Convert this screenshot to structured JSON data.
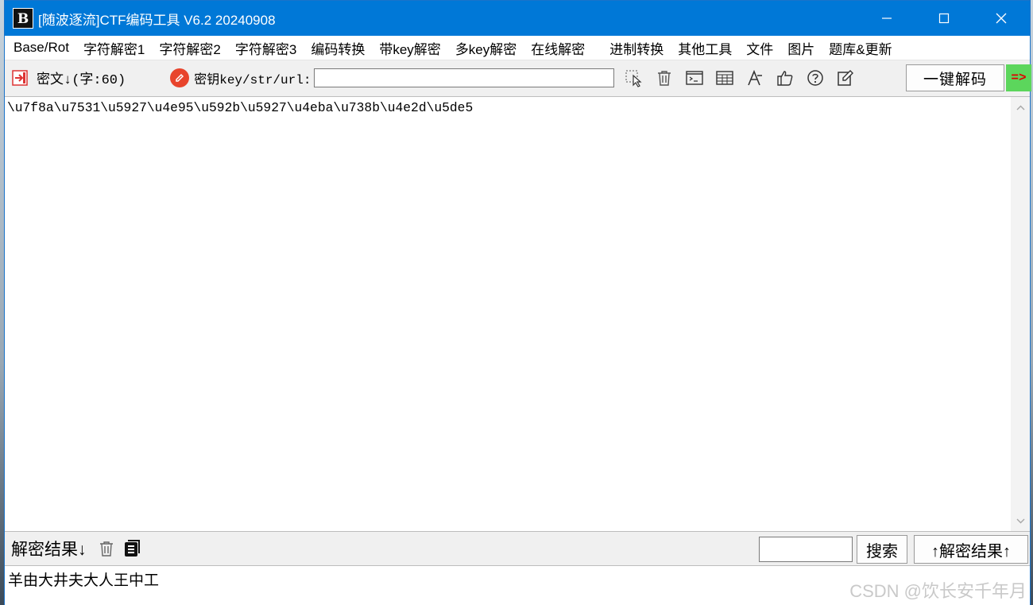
{
  "window": {
    "logo": "B",
    "title": "[随波逐流]CTF编码工具 V6.2 20240908"
  },
  "menu": [
    "Base/Rot",
    "字符解密1",
    "字符解密2",
    "字符解密3",
    "编码转换",
    "带key解密",
    "多key解密",
    "在线解密",
    "进制转换",
    "其他工具",
    "文件",
    "图片",
    "题库&更新"
  ],
  "toolbar": {
    "cipher_label": "密文↓(字:60)",
    "key_label": "密钥key/str/url:",
    "key_value": "",
    "decode_button": "一键解码",
    "go_arrow": "=>",
    "tool_icons": [
      "cursor-select-icon",
      "trash-icon",
      "terminal-icon",
      "table-icon",
      "font-icon",
      "thumbs-up-icon",
      "help-icon",
      "edit-icon"
    ]
  },
  "cipher": {
    "text": "\\u7f8a\\u7531\\u5927\\u4e95\\u592b\\u5927\\u4eba\\u738b\\u4e2d\\u5de5"
  },
  "result_bar": {
    "label": "解密结果↓",
    "search_value": "",
    "search_button": "搜索",
    "up_button": "↑解密结果↑"
  },
  "result": {
    "text": "羊由大井夫大人王中工"
  },
  "watermark": "CSDN @饮长安千年月",
  "colors": {
    "titlebar": "#0078d7",
    "key_icon": "#e8442c",
    "go_arrow_bg": "#5cd65c",
    "go_arrow_fg": "#e00000"
  }
}
